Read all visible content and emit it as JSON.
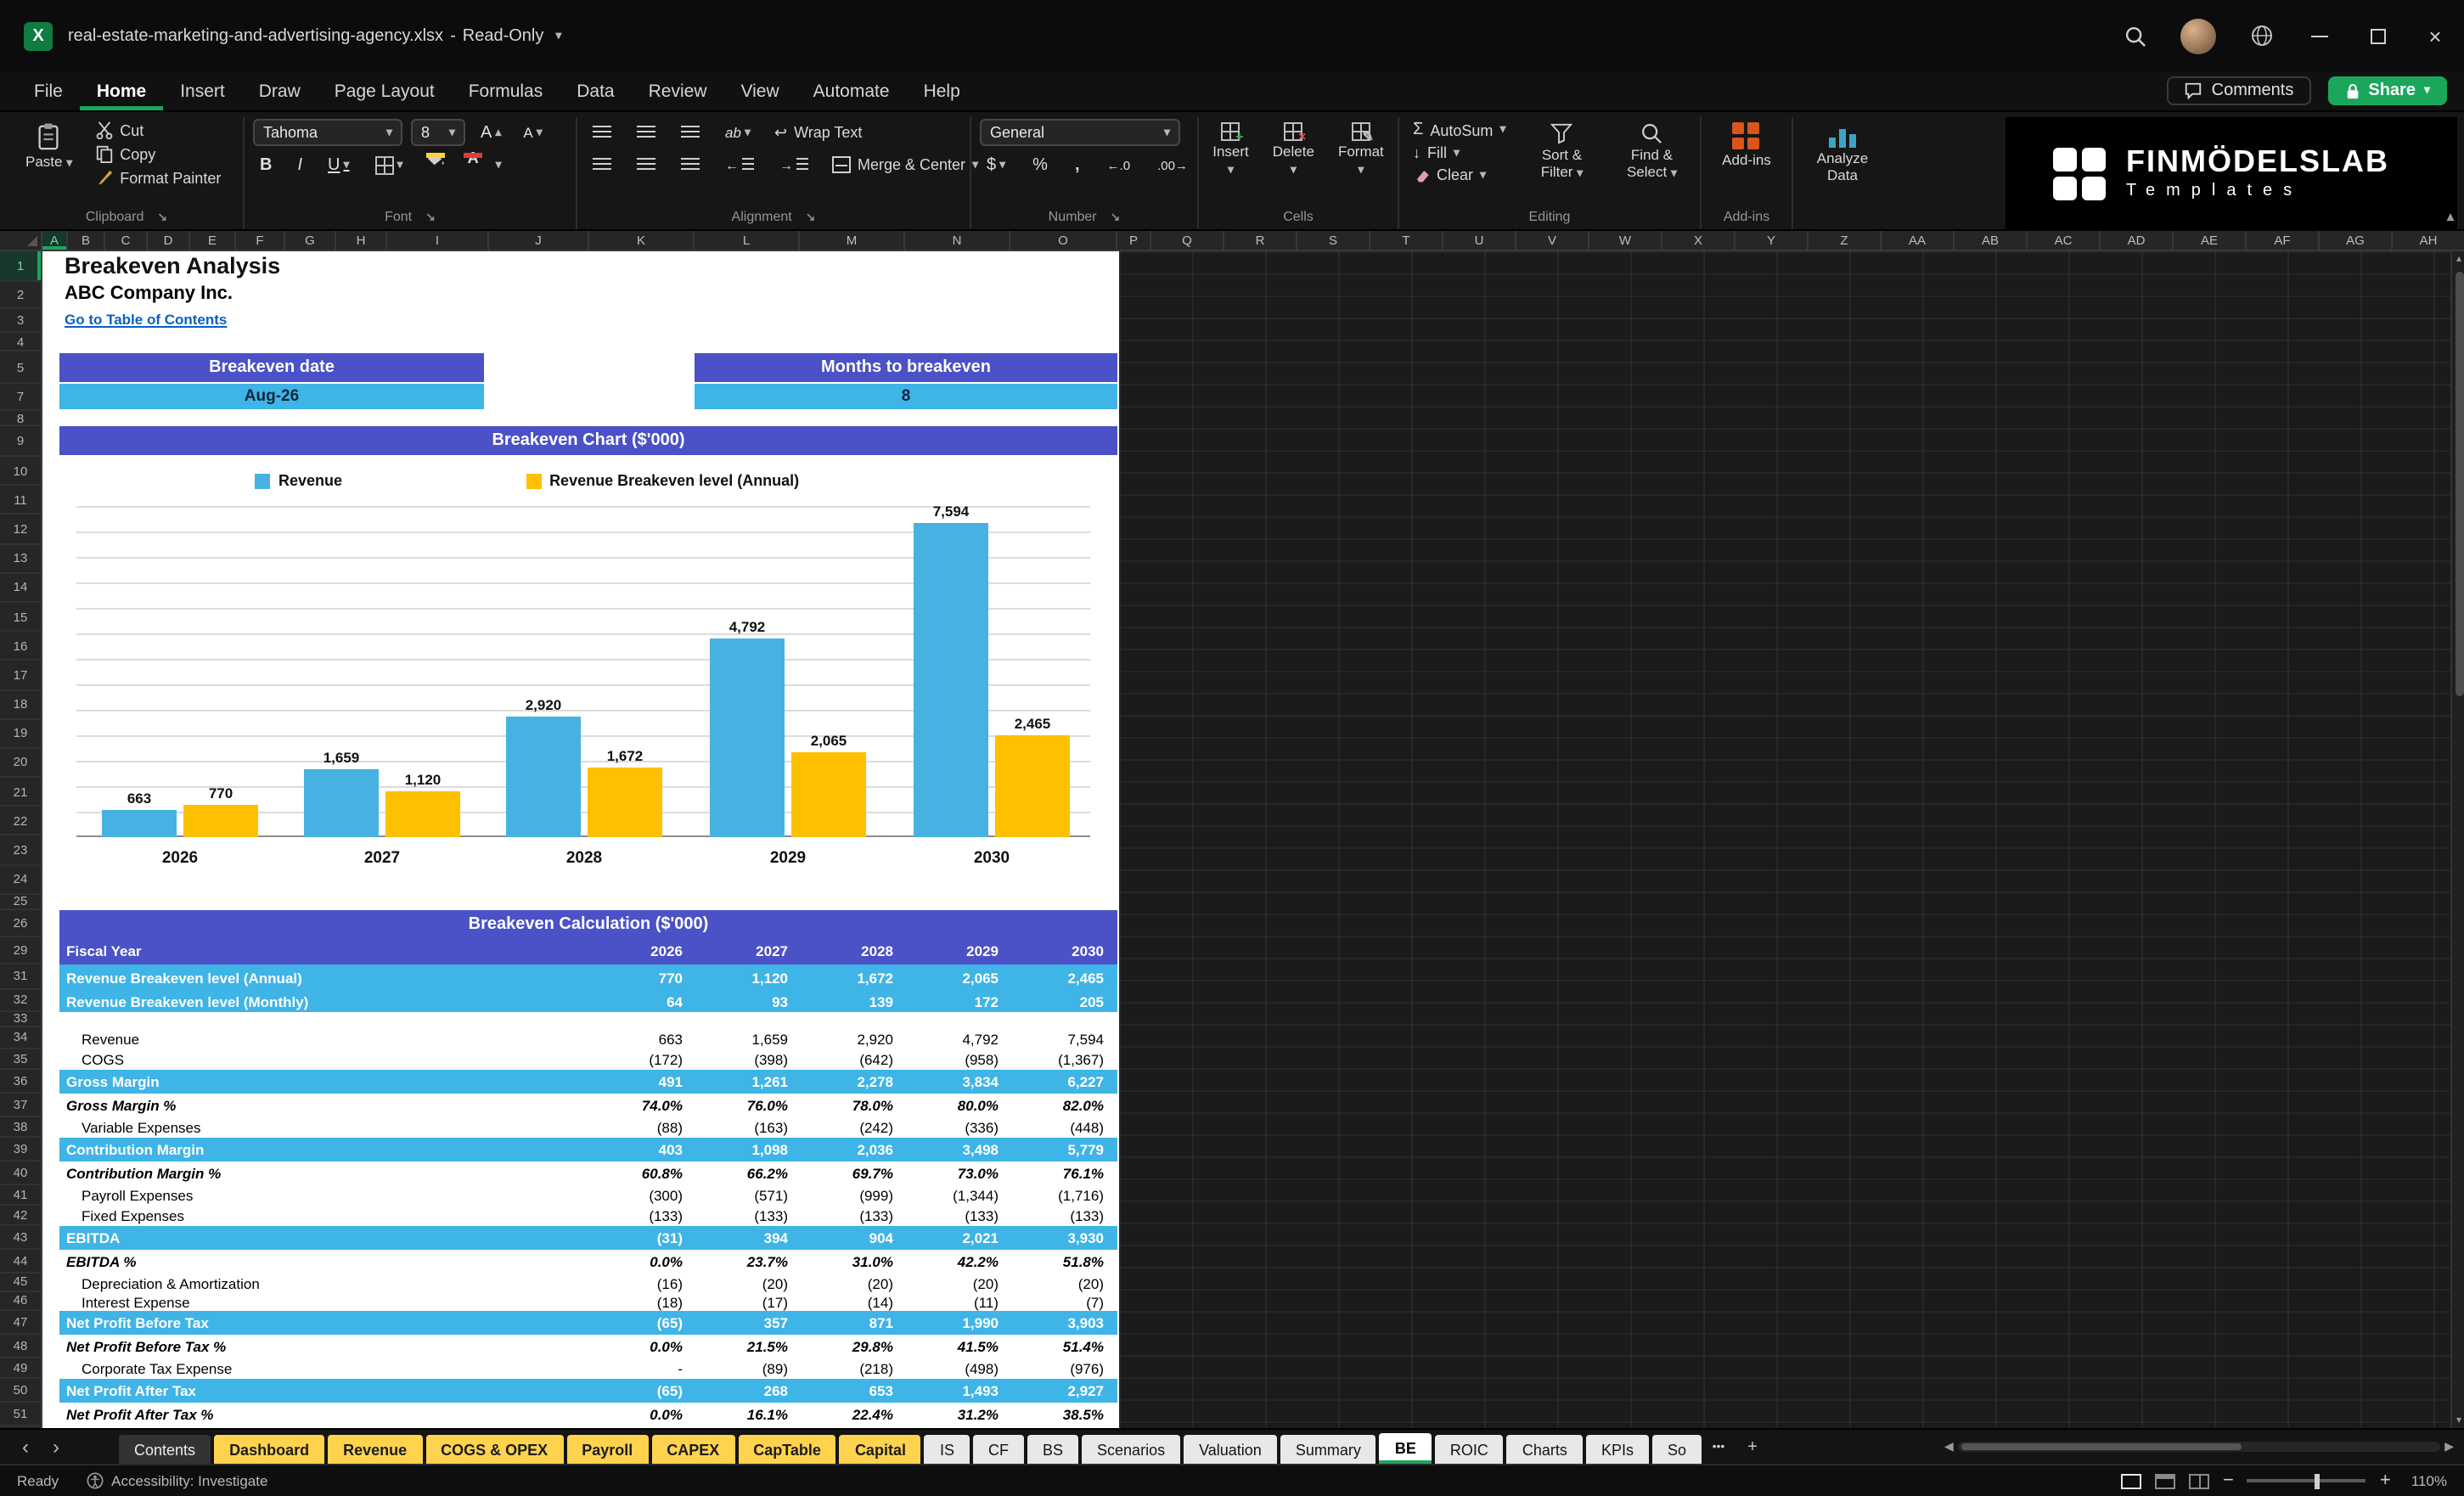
{
  "colors": {
    "green": "#1aa75c",
    "banner": "#4b51c6",
    "rowblue": "#3fb4e6",
    "barblue": "#47b2e2",
    "baryellow": "#ffc000",
    "tabyellow": "#ffd34d",
    "link": "#0b61c1"
  },
  "title_bar": {
    "file_name": "real-estate-marketing-and-advertising-agency.xlsx",
    "separator": "-",
    "mode": "Read-Only"
  },
  "menu": {
    "items": [
      "File",
      "Home",
      "Insert",
      "Draw",
      "Page Layout",
      "Formulas",
      "Data",
      "Review",
      "View",
      "Automate",
      "Help"
    ],
    "active": "Home",
    "comments_label": "Comments",
    "share_label": "Share"
  },
  "ribbon": {
    "clipboard": {
      "label": "Clipboard",
      "paste": "Paste",
      "cut": "Cut",
      "copy": "Copy",
      "format_painter": "Format Painter"
    },
    "font": {
      "label": "Font",
      "family": "Tahoma",
      "size": "8"
    },
    "alignment": {
      "label": "Alignment",
      "wrap_text": "Wrap Text",
      "merge_center": "Merge & Center"
    },
    "number": {
      "label": "Number",
      "format": "General"
    },
    "cells": {
      "label": "Cells",
      "insert": "Insert",
      "delete": "Delete",
      "format": "Format"
    },
    "editing": {
      "label": "Editing",
      "autosum": "AutoSum",
      "fill": "Fill",
      "clear": "Clear",
      "sort_filter": "Sort & Filter",
      "find_select": "Find & Select"
    },
    "addins": {
      "label": "Add-ins",
      "addins": "Add-ins",
      "analyze": "Analyze Data"
    },
    "logo": {
      "brand": "FINMÖDELSLAB",
      "sub": "Templates"
    }
  },
  "grid": {
    "columns": [
      "A",
      "B",
      "C",
      "D",
      "E",
      "F",
      "G",
      "H",
      "I",
      "J",
      "K",
      "L",
      "M",
      "N",
      "O",
      "P",
      "Q",
      "R",
      "S",
      "T",
      "U",
      "V",
      "W",
      "X",
      "Y",
      "Z",
      "AA",
      "AB",
      "AC",
      "AD",
      "AE",
      "AF",
      "AG",
      "AH"
    ],
    "rows": [
      1,
      2,
      3,
      4,
      5,
      7,
      8,
      9,
      10,
      11,
      12,
      13,
      14,
      15,
      16,
      17,
      18,
      19,
      20,
      21,
      22,
      23,
      24,
      25,
      26,
      29,
      31,
      32,
      33,
      34,
      35,
      36,
      37,
      38,
      39,
      40,
      41,
      42,
      43,
      44,
      45,
      46,
      47,
      48,
      49,
      50,
      51
    ]
  },
  "sheet": {
    "title": "Breakeven Analysis",
    "company": "ABC Company Inc.",
    "link": "Go to Table of Contents",
    "breakeven_date_label": "Breakeven date",
    "breakeven_date_value": "Aug-26",
    "months_label": "Months to breakeven",
    "months_value": "8",
    "chart_banner": "Breakeven Chart ($'000)",
    "calc_banner": "Breakeven Calculation ($'000)",
    "fiscal_header": {
      "label": "Fiscal Year",
      "years": [
        "2026",
        "2027",
        "2028",
        "2029",
        "2030"
      ]
    }
  },
  "chart_data": {
    "type": "bar",
    "title": "Breakeven Chart ($'000)",
    "categories": [
      "2026",
      "2027",
      "2028",
      "2029",
      "2030"
    ],
    "series": [
      {
        "name": "Revenue",
        "color": "#47b2e2",
        "values": [
          663,
          1659,
          2920,
          4792,
          7594
        ]
      },
      {
        "name": "Revenue Breakeven level (Annual)",
        "color": "#ffc000",
        "values": [
          770,
          1120,
          1672,
          2065,
          2465
        ]
      }
    ],
    "ylim": [
      0,
      8000
    ],
    "grid": true,
    "legend_position": "top",
    "xlabel": "",
    "ylabel": ""
  },
  "table": {
    "rows": [
      {
        "row": 31,
        "label": "Revenue Breakeven level (Annual)",
        "values": [
          "770",
          "1,120",
          "1,672",
          "2,065",
          "2,465"
        ],
        "style": "highlight"
      },
      {
        "row": 32,
        "label": "Revenue Breakeven level (Monthly)",
        "values": [
          "64",
          "93",
          "139",
          "172",
          "205"
        ],
        "style": "highlight"
      },
      {
        "row": 33,
        "label": "",
        "values": [],
        "style": "spacer"
      },
      {
        "row": 34,
        "label": "Revenue",
        "values": [
          "663",
          "1,659",
          "2,920",
          "4,792",
          "7,594"
        ],
        "style": "normal"
      },
      {
        "row": 35,
        "label": "COGS",
        "values": [
          "(172)",
          "(398)",
          "(642)",
          "(958)",
          "(1,367)"
        ],
        "style": "normal"
      },
      {
        "row": 36,
        "label": "Gross Margin",
        "values": [
          "491",
          "1,261",
          "2,278",
          "3,834",
          "6,227"
        ],
        "style": "highlight"
      },
      {
        "row": 37,
        "label": "Gross Margin %",
        "values": [
          "74.0%",
          "76.0%",
          "78.0%",
          "80.0%",
          "82.0%"
        ],
        "style": "percent"
      },
      {
        "row": 38,
        "label": "Variable Expenses",
        "values": [
          "(88)",
          "(163)",
          "(242)",
          "(336)",
          "(448)"
        ],
        "style": "normal"
      },
      {
        "row": 39,
        "label": "Contribution Margin",
        "values": [
          "403",
          "1,098",
          "2,036",
          "3,498",
          "5,779"
        ],
        "style": "highlight"
      },
      {
        "row": 40,
        "label": "Contribution Margin %",
        "values": [
          "60.8%",
          "66.2%",
          "69.7%",
          "73.0%",
          "76.1%"
        ],
        "style": "percent"
      },
      {
        "row": 41,
        "label": "Payroll Expenses",
        "values": [
          "(300)",
          "(571)",
          "(999)",
          "(1,344)",
          "(1,716)"
        ],
        "style": "normal"
      },
      {
        "row": 42,
        "label": "Fixed Expenses",
        "values": [
          "(133)",
          "(133)",
          "(133)",
          "(133)",
          "(133)"
        ],
        "style": "normal"
      },
      {
        "row": 43,
        "label": "EBITDA",
        "values": [
          "(31)",
          "394",
          "904",
          "2,021",
          "3,930"
        ],
        "style": "highlight"
      },
      {
        "row": 44,
        "label": "EBITDA %",
        "values": [
          "0.0%",
          "23.7%",
          "31.0%",
          "42.2%",
          "51.8%"
        ],
        "style": "percent"
      },
      {
        "row": 45,
        "label": "Depreciation & Amortization",
        "values": [
          "(16)",
          "(20)",
          "(20)",
          "(20)",
          "(20)"
        ],
        "style": "normal"
      },
      {
        "row": 46,
        "label": "Interest Expense",
        "values": [
          "(18)",
          "(17)",
          "(14)",
          "(11)",
          "(7)"
        ],
        "style": "normal"
      },
      {
        "row": 47,
        "label": "Net Profit Before Tax",
        "values": [
          "(65)",
          "357",
          "871",
          "1,990",
          "3,903"
        ],
        "style": "highlight"
      },
      {
        "row": 48,
        "label": "Net Profit Before Tax %",
        "values": [
          "0.0%",
          "21.5%",
          "29.8%",
          "41.5%",
          "51.4%"
        ],
        "style": "percent"
      },
      {
        "row": 49,
        "label": "Corporate Tax Expense",
        "values": [
          "-",
          "(89)",
          "(218)",
          "(498)",
          "(976)"
        ],
        "style": "normal"
      },
      {
        "row": 50,
        "label": "Net Profit After Tax",
        "values": [
          "(65)",
          "268",
          "653",
          "1,493",
          "2,927"
        ],
        "style": "highlight"
      },
      {
        "row": 51,
        "label": "Net Profit After Tax %",
        "values": [
          "0.0%",
          "16.1%",
          "22.4%",
          "31.2%",
          "38.5%"
        ],
        "style": "percent"
      }
    ]
  },
  "sheet_tabs": {
    "tabs": [
      {
        "label": "Contents",
        "type": "dark"
      },
      {
        "label": "Dashboard",
        "type": "yellow"
      },
      {
        "label": "Revenue",
        "type": "yellow"
      },
      {
        "label": "COGS & OPEX",
        "type": "yellow"
      },
      {
        "label": "Payroll",
        "type": "yellow"
      },
      {
        "label": "CAPEX",
        "type": "yellow"
      },
      {
        "label": "CapTable",
        "type": "yellow"
      },
      {
        "label": "Capital",
        "type": "yellow"
      },
      {
        "label": "IS",
        "type": "light"
      },
      {
        "label": "CF",
        "type": "light"
      },
      {
        "label": "BS",
        "type": "light"
      },
      {
        "label": "Scenarios",
        "type": "light"
      },
      {
        "label": "Valuation",
        "type": "light"
      },
      {
        "label": "Summary",
        "type": "light"
      },
      {
        "label": "BE",
        "type": "active"
      },
      {
        "label": "ROIC",
        "type": "light"
      },
      {
        "label": "Charts",
        "type": "light"
      },
      {
        "label": "KPIs",
        "type": "light"
      },
      {
        "label": "So",
        "type": "light"
      }
    ],
    "overflow": "•••",
    "add": "+"
  },
  "status_bar": {
    "ready": "Ready",
    "accessibility": "Accessibility: Investigate",
    "zoom": "110%"
  }
}
